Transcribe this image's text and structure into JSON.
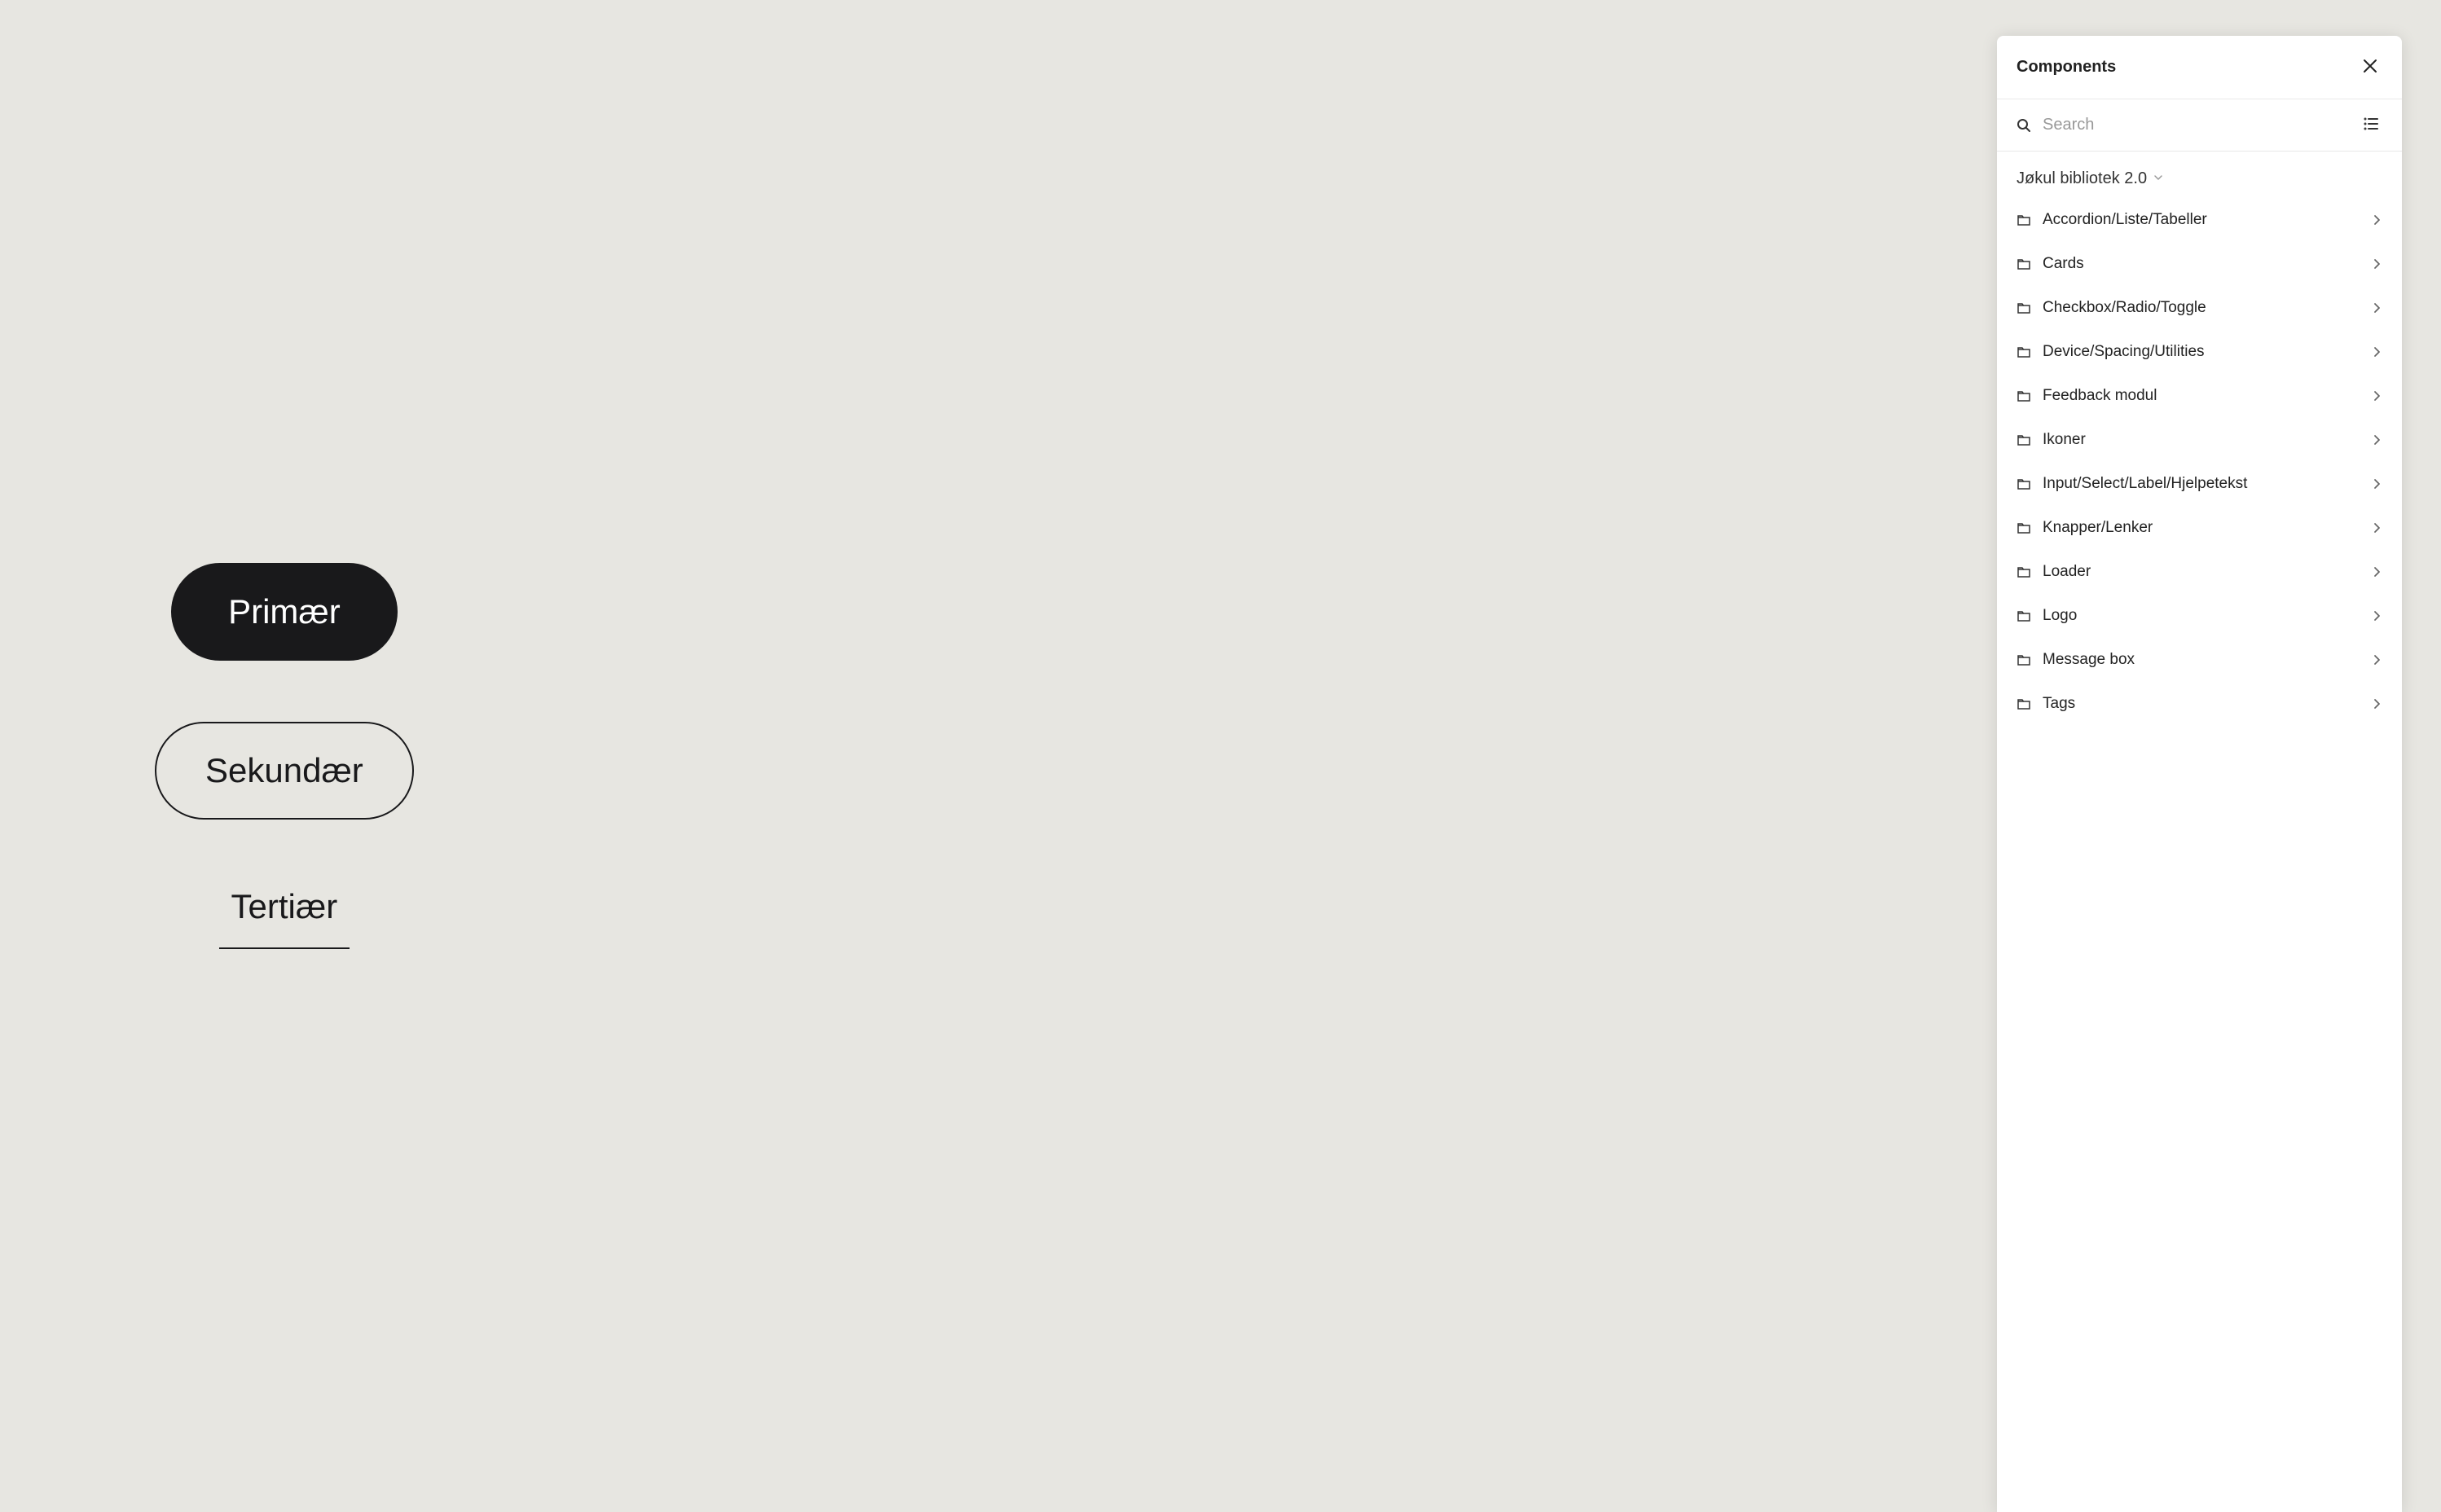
{
  "canvas": {
    "buttons": {
      "primary": "Primær",
      "secondary": "Sekundær",
      "tertiary": "Tertiær"
    }
  },
  "panel": {
    "title": "Components",
    "search_placeholder": "Search",
    "library_name": "Jøkul bibliotek 2.0",
    "folders": [
      {
        "label": "Accordion/Liste/Tabeller"
      },
      {
        "label": "Cards"
      },
      {
        "label": "Checkbox/Radio/Toggle"
      },
      {
        "label": "Device/Spacing/Utilities"
      },
      {
        "label": "Feedback modul"
      },
      {
        "label": "Ikoner"
      },
      {
        "label": "Input/Select/Label/Hjelpetekst"
      },
      {
        "label": "Knapper/Lenker"
      },
      {
        "label": "Loader"
      },
      {
        "label": "Logo"
      },
      {
        "label": "Message box"
      },
      {
        "label": "Tags"
      }
    ]
  }
}
